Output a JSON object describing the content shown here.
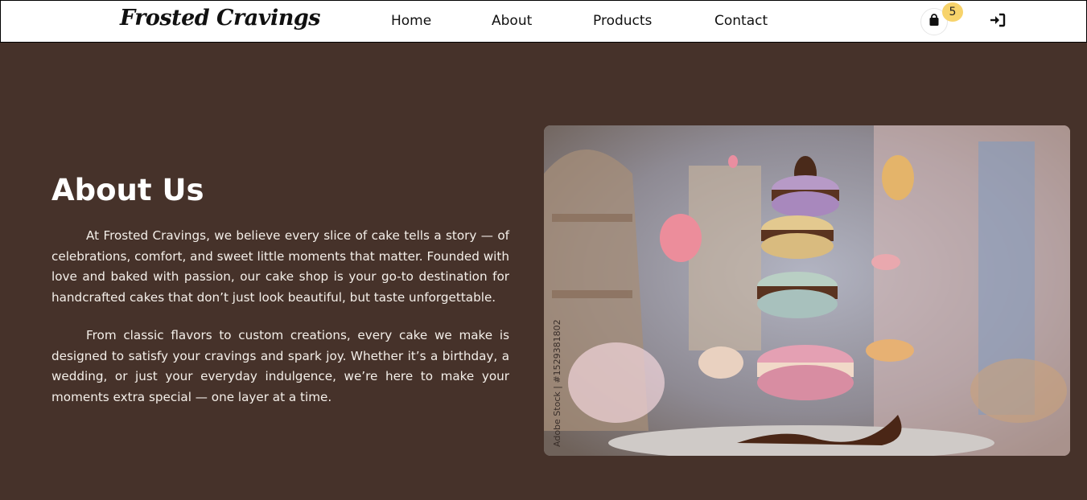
{
  "nav": {
    "logo": "Frosted Cravings",
    "links": [
      "Home",
      "About",
      "Products",
      "Contact"
    ],
    "cart_count": "5",
    "icons": {
      "cart": "shopping-bag-icon",
      "login": "sign-in-icon"
    }
  },
  "about": {
    "title": "About Us",
    "paragraphs": [
      "At Frosted Cravings, we believe every slice of cake tells a story — of celebrations, comfort, and sweet little moments that matter. Founded with love and baked with passion, our cake shop is your go-to destination for handcrafted cakes that don’t just look beautiful, but taste unforgettable.",
      "From classic flavors to custom creations, every cake we make is designed to satisfy your cravings and spark joy. Whether it’s a birthday, a wedding, or just your everyday indulgence, we’re here to make your moments extra special — one layer at a time."
    ],
    "image_watermark": "Adobe Stock | #1529381802"
  },
  "colors": {
    "background": "#46322a",
    "navbar": "#ffffff",
    "badge": "#f7d36b",
    "text": "#ffffff"
  }
}
